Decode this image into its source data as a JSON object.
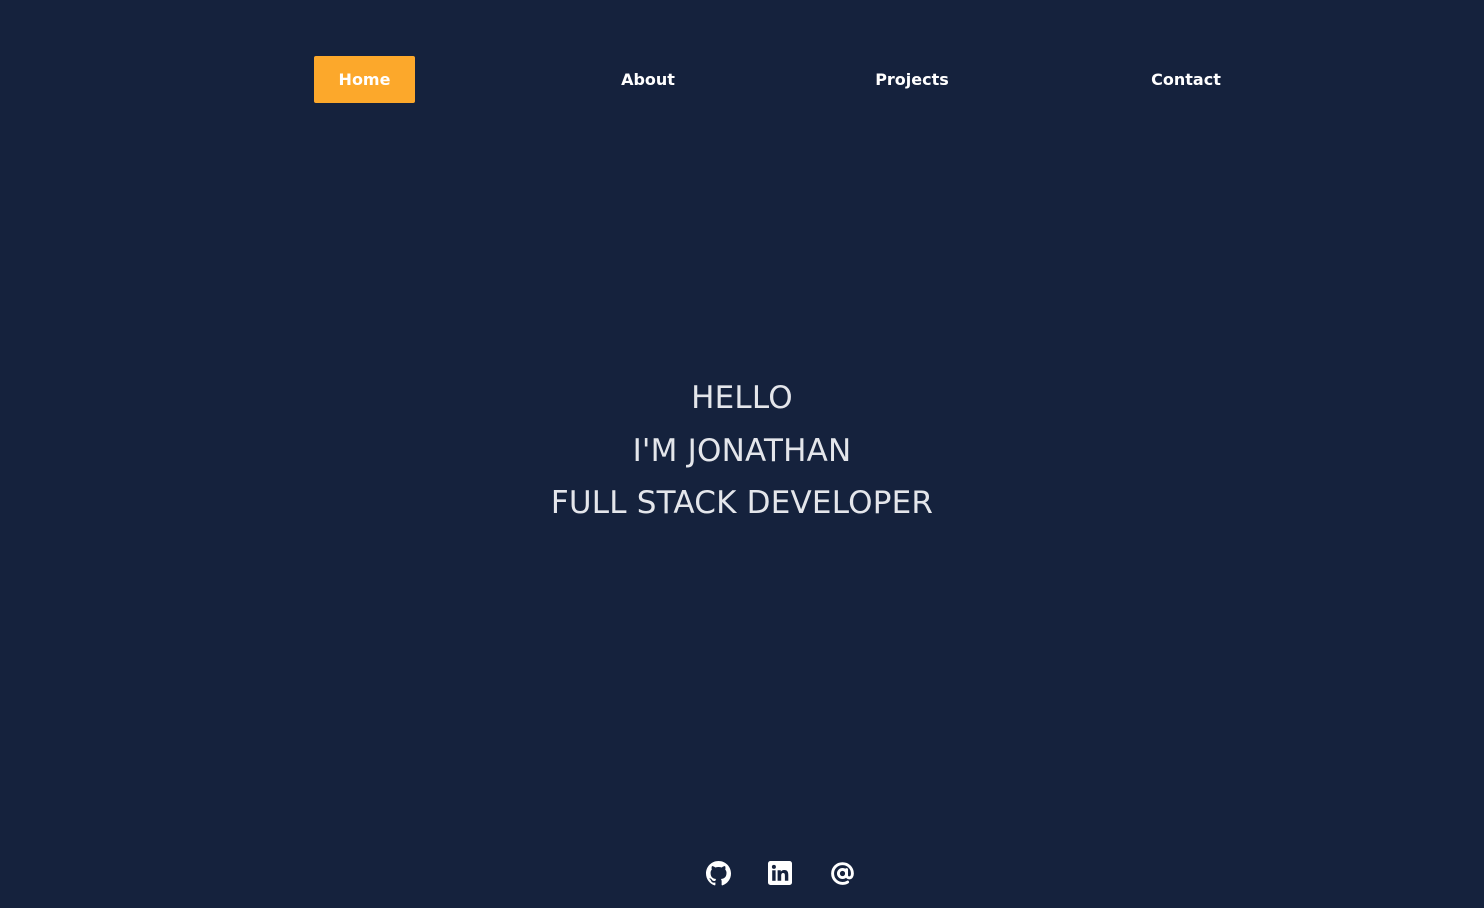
{
  "nav": {
    "items": [
      {
        "label": "Home",
        "active": true
      },
      {
        "label": "About",
        "active": false
      },
      {
        "label": "Projects",
        "active": false
      },
      {
        "label": "Contact",
        "active": false
      }
    ]
  },
  "hero": {
    "greeting": "HELLO",
    "name_line": "I'M JONATHAN",
    "role": "FULL STACK DEVELOPER"
  },
  "socials": [
    {
      "icon": "github-icon"
    },
    {
      "icon": "linkedin-icon"
    },
    {
      "icon": "at-sign-icon"
    }
  ],
  "colors": {
    "background": "#15223d",
    "accent": "#fca82b",
    "text": "#ffffff",
    "hero_text": "#e4e6eb"
  }
}
